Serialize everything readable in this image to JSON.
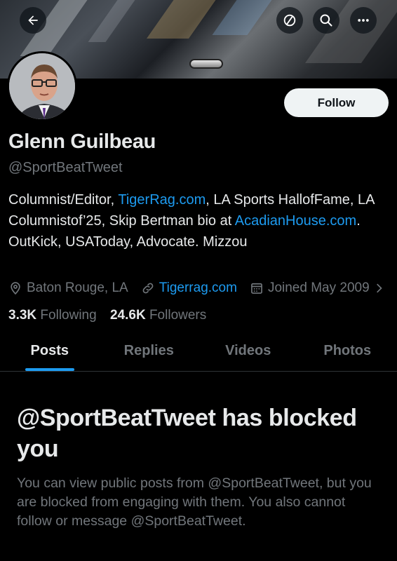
{
  "header": {
    "back_icon": "arrow-left-icon",
    "cancel_icon": "circle-slash-icon",
    "search_icon": "search-icon",
    "more_icon": "more-dots-icon"
  },
  "profile": {
    "name": "Glenn Guilbeau",
    "handle": "@SportBeatTweet",
    "follow_label": "Follow",
    "bio": {
      "part1": "Columnist/Editor, ",
      "link1": "TigerRag.com",
      "part2": ", LA Sports HallofFame, LA Columnistof’25, Skip Bertman bio at ",
      "link2": "AcadianHouse.com",
      "part3": ". OutKick, USAToday, Advocate. Mizzou"
    },
    "location": "Baton Rouge, LA",
    "website": "Tigerrag.com",
    "joined": "Joined May 2009",
    "following_count": "3.3K",
    "following_label": "Following",
    "followers_count": "24.6K",
    "followers_label": "Followers"
  },
  "tabs": [
    {
      "label": "Posts",
      "active": true
    },
    {
      "label": "Replies",
      "active": false
    },
    {
      "label": "Videos",
      "active": false
    },
    {
      "label": "Photos",
      "active": false
    }
  ],
  "blocked": {
    "title": "@SportBeatTweet has blocked you",
    "body": "You can view public posts from @SportBeatTweet, but you are blocked from engaging with them. You also cannot follow or message @SportBeatTweet."
  },
  "colors": {
    "accent": "#1d9bf0",
    "background": "#000000",
    "muted": "#71767b"
  }
}
